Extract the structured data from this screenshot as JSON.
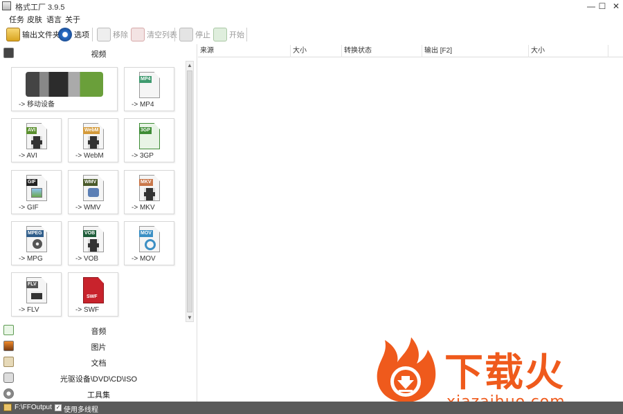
{
  "window": {
    "title": "格式工厂 3.9.5",
    "minimize": "—",
    "maximize": "☐",
    "close": "✕"
  },
  "menu": [
    "任务",
    "皮肤",
    "语言",
    "关于"
  ],
  "toolbar": {
    "output_folder": "输出文件夹",
    "options": "选项",
    "remove": "移除",
    "clear_list": "清空列表",
    "stop": "停止",
    "start": "开始"
  },
  "categories": {
    "video": "视频",
    "audio": "音频",
    "image": "图片",
    "document": "文档",
    "rom": "光驱设备\\DVD\\CD\\ISO",
    "utilities": "工具集"
  },
  "tiles": {
    "mobile": "-> 移动设备",
    "mp4": "-> MP4",
    "avi": "-> AVI",
    "webm": "-> WebM",
    "3gp": "-> 3GP",
    "gif": "-> GIF",
    "wmv": "-> WMV",
    "mkv": "-> MKV",
    "mpg": "-> MPG",
    "vob": "-> VOB",
    "mov": "-> MOV",
    "flv": "-> FLV",
    "swf": "-> SWF"
  },
  "badges": {
    "mp4": "MP4",
    "avi": "AVI",
    "webm": "WebM",
    "3gp": "3GP",
    "gif": "GIF",
    "wmv": "WMV",
    "mkv": "MKV",
    "mpg": "MPEG",
    "vob": "VOB",
    "mov": "MOV",
    "flv": "FLV",
    "swf": "SWF"
  },
  "table": {
    "columns": [
      "来源",
      "大小",
      "转换状态",
      "输出 [F2]",
      "大小"
    ]
  },
  "status": {
    "output_path": "F:\\FFOutput",
    "checkbox_label": "使用多线程",
    "checked": "✓"
  },
  "watermark": {
    "brand": "下载火",
    "url": "xiazaihuo.com"
  },
  "colors": {
    "accent": "#ef5a1c",
    "statusbar": "#5a5a5a"
  }
}
